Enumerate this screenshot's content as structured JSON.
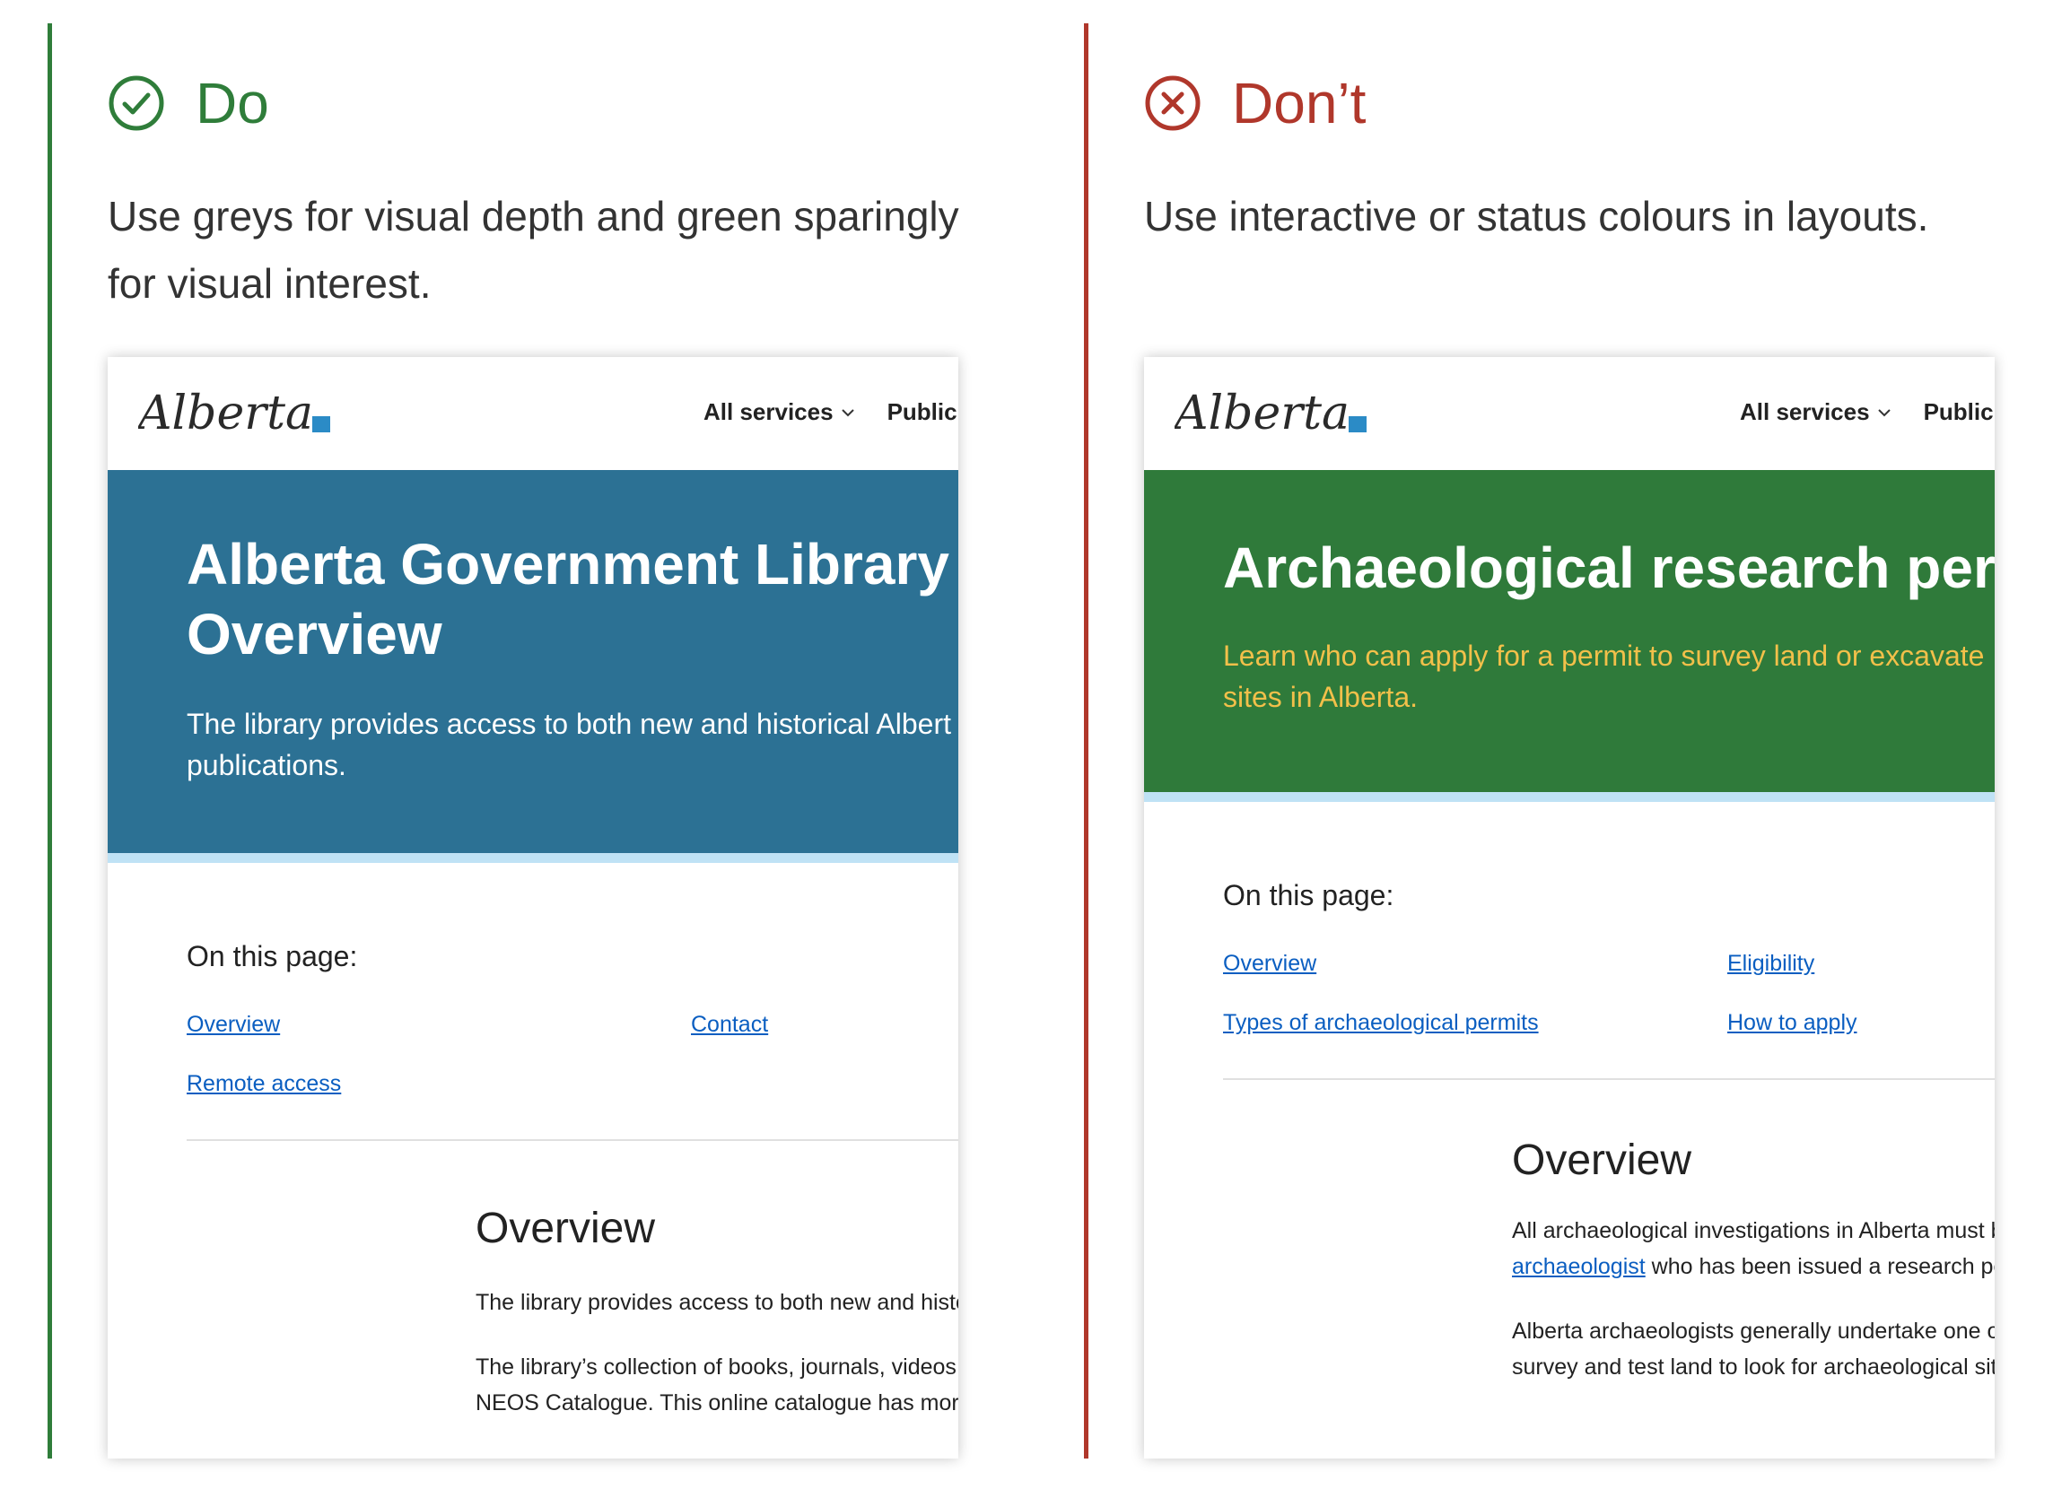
{
  "do": {
    "label": "Do",
    "description_line1": "Use greys for visual depth and green sparingly",
    "description_line2": "for visual interest.",
    "icon": "check-circle-icon",
    "color": "#2f7d3a",
    "example": {
      "logo_text": "Alberta",
      "nav": [
        "All services",
        "Public"
      ],
      "hero_color": "#2c7194",
      "hero_title_line1": "Alberta Government Library",
      "hero_title_line2": "Overview",
      "hero_lead_line1": "The library provides access to both new and historical Albert",
      "hero_lead_line2": "publications.",
      "toc_title": "On this page:",
      "toc_links": [
        "Overview",
        "Contact",
        "Remote access"
      ],
      "section_title": "Overview",
      "section_line1": "The library provides access to both new and histor",
      "section_line2": "The library’s collection of books, journals, videos a",
      "section_line3": "NEOS Catalogue. This online catalogue has more t"
    }
  },
  "dont": {
    "label": "Don’t",
    "description": "Use interactive or status colours in layouts.",
    "icon": "x-circle-icon",
    "color": "#b0372b",
    "example": {
      "logo_text": "Alberta",
      "nav": [
        "All services",
        "Public"
      ],
      "hero_color": "#2f7a3a",
      "hero_title": "Archaeological research per",
      "hero_lead_line1": "Learn who can apply for a permit to survey land or excavate",
      "hero_lead_line2": "sites in Alberta.",
      "toc_title": "On this page:",
      "toc_links": [
        "Overview",
        "Eligibility",
        "Types of archaeological permits",
        "How to apply"
      ],
      "section_title": "Overview",
      "section_line1": "All archaeological investigations in Alberta must b",
      "section_link": "archaeologist",
      "section_line2_rest": " who has been issued a research per",
      "section_line3": "Alberta archaeologists generally undertake one of",
      "section_line4": "survey and test land to look for archaeological site"
    }
  }
}
